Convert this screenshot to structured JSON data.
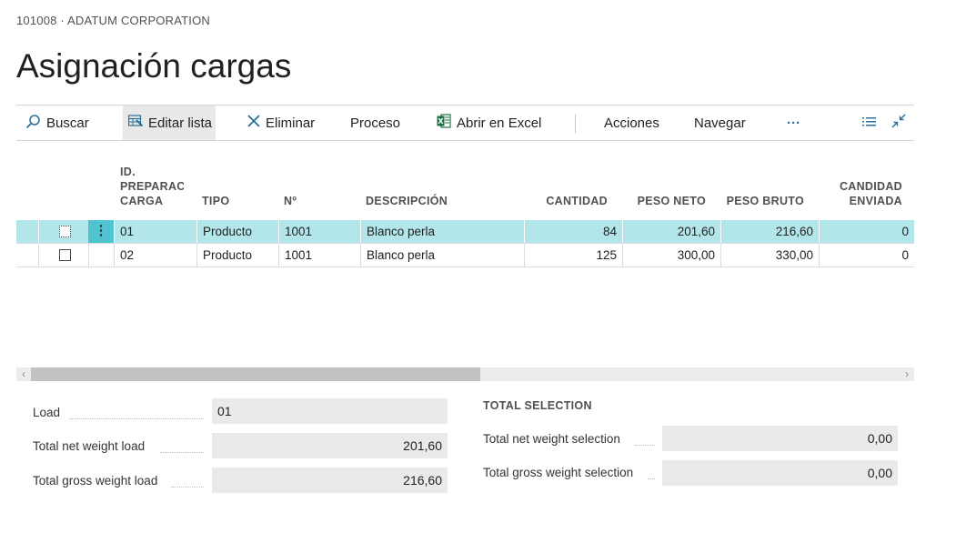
{
  "company": "101008 · ADATUM CORPORATION",
  "title": "Asignación cargas",
  "toolbar": {
    "search": "Buscar",
    "edit_list": "Editar lista",
    "delete": "Eliminar",
    "process": "Proceso",
    "open_excel": "Abrir en Excel",
    "actions": "Acciones",
    "navigate": "Navegar",
    "more": "···"
  },
  "columns": {
    "id_line1": "ID.",
    "id_line2": "PREPARAC",
    "id_line3": "CARGA",
    "tipo": "TIPO",
    "no": "Nº",
    "descripcion": "DESCRIPCIÓN",
    "cantidad": "CANTIDAD",
    "peso_neto": "PESO NETO",
    "peso_bruto": "PESO BRUTO",
    "cant_enviada_line1": "CANDIDAD",
    "cant_enviada_line2": "ENVIADA"
  },
  "rows": [
    {
      "id": "01",
      "tipo": "Producto",
      "no": "1001",
      "descripcion": "Blanco perla",
      "cantidad": "84",
      "peso_neto": "201,60",
      "peso_bruto": "216,60",
      "enviada": "0",
      "selected": true
    },
    {
      "id": "02",
      "tipo": "Producto",
      "no": "1001",
      "descripcion": "Blanco perla",
      "cantidad": "125",
      "peso_neto": "300,00",
      "peso_bruto": "330,00",
      "enviada": "0",
      "selected": false
    }
  ],
  "fields": {
    "load_label": "Load",
    "load_value": "01",
    "net_label": "Total net weight load",
    "net_value": "201,60",
    "gross_label": "Total gross weight load",
    "gross_value": "216,60"
  },
  "selection": {
    "title": "TOTAL SELECTION",
    "net_label": "Total net weight selection",
    "net_value": "0,00",
    "gross_label": "Total gross weight selection",
    "gross_value": "0,00"
  },
  "colors": {
    "selected_row": "#b3e6ea",
    "row_menu": "#4fc3cf",
    "excel_green": "#1e7145",
    "accent": "#2a6f96"
  }
}
